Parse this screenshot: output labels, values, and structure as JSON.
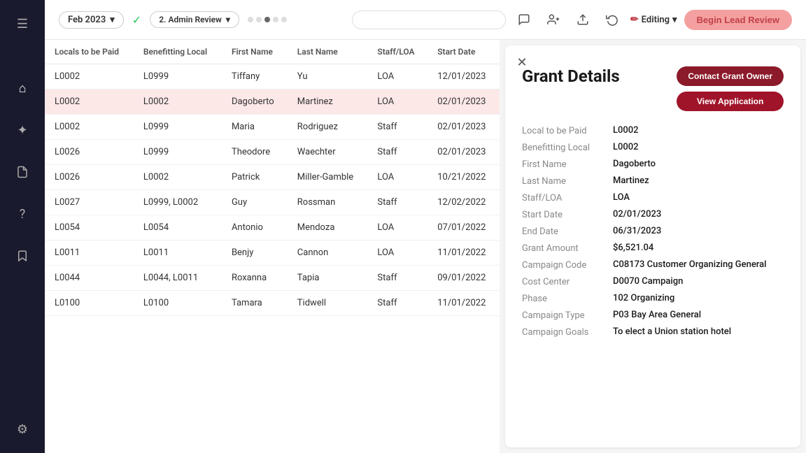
{
  "sidebar": {
    "icons": [
      {
        "name": "menu-icon",
        "symbol": "☰"
      },
      {
        "name": "home-icon",
        "symbol": "⌂"
      },
      {
        "name": "magic-icon",
        "symbol": "✦"
      },
      {
        "name": "document-icon",
        "symbol": "📄"
      },
      {
        "name": "help-icon",
        "symbol": "?"
      },
      {
        "name": "bookmark-icon",
        "symbol": "🔖"
      },
      {
        "name": "settings-icon",
        "symbol": "⚙"
      }
    ]
  },
  "topbar": {
    "date_label": "Feb 2023",
    "step_label": "2. Admin Review",
    "search_placeholder": "",
    "begin_review_label": "Begin Lead Review",
    "editing_label": "Editing"
  },
  "table": {
    "columns": [
      "Locals to be Paid",
      "Benefitting Local",
      "First Name",
      "Last Name",
      "Staff/LOA",
      "Start Date"
    ],
    "rows": [
      {
        "locals_paid": "L0002",
        "benefitting": "L0999",
        "first_name": "Tiffany",
        "last_name": "Yu",
        "staff_loa": "LOA",
        "start_date": "12/01/2023",
        "selected": false
      },
      {
        "locals_paid": "L0002",
        "benefitting": "L0002",
        "first_name": "Dagoberto",
        "last_name": "Martinez",
        "staff_loa": "LOA",
        "start_date": "02/01/2023",
        "selected": true
      },
      {
        "locals_paid": "L0002",
        "benefitting": "L0999",
        "first_name": "Maria",
        "last_name": "Rodriguez",
        "staff_loa": "Staff",
        "start_date": "02/01/2023",
        "selected": false
      },
      {
        "locals_paid": "L0026",
        "benefitting": "L0999",
        "first_name": "Theodore",
        "last_name": "Waechter",
        "staff_loa": "Staff",
        "start_date": "02/01/2023",
        "selected": false
      },
      {
        "locals_paid": "L0026",
        "benefitting": "L0002",
        "first_name": "Patrick",
        "last_name": "Miller-Gamble",
        "staff_loa": "LOA",
        "start_date": "10/21/2022",
        "selected": false
      },
      {
        "locals_paid": "L0027",
        "benefitting": "L0999, L0002",
        "first_name": "Guy",
        "last_name": "Rossman",
        "staff_loa": "Staff",
        "start_date": "12/02/2022",
        "selected": false
      },
      {
        "locals_paid": "L0054",
        "benefitting": "L0054",
        "first_name": "Antonio",
        "last_name": "Mendoza",
        "staff_loa": "LOA",
        "start_date": "07/01/2022",
        "selected": false
      },
      {
        "locals_paid": "L0011",
        "benefitting": "L0011",
        "first_name": "Benjy",
        "last_name": "Cannon",
        "staff_loa": "LOA",
        "start_date": "11/01/2022",
        "selected": false
      },
      {
        "locals_paid": "L0044",
        "benefitting": "L0044, L0011",
        "first_name": "Roxanna",
        "last_name": "Tapia",
        "staff_loa": "Staff",
        "start_date": "09/01/2022",
        "selected": false
      },
      {
        "locals_paid": "L0100",
        "benefitting": "L0100",
        "first_name": "Tamara",
        "last_name": "Tidwell",
        "staff_loa": "Staff",
        "start_date": "11/01/2022",
        "selected": false
      }
    ]
  },
  "detail": {
    "title": "Grant Details",
    "contact_label": "Contact Grant Owner",
    "view_label": "View Application",
    "fields": [
      {
        "label": "Local to be Paid",
        "value": "L0002"
      },
      {
        "label": "Benefitting Local",
        "value": "L0002"
      },
      {
        "label": "First Name",
        "value": "Dagoberto"
      },
      {
        "label": "Last Name",
        "value": "Martinez"
      },
      {
        "label": "Staff/LOA",
        "value": "LOA"
      },
      {
        "label": "Start Date",
        "value": "02/01/2023"
      },
      {
        "label": "End Date",
        "value": "06/31/2023"
      },
      {
        "label": "Grant Amount",
        "value": "$6,521.04"
      },
      {
        "label": "Campaign Code",
        "value": "C08173 Customer Organizing General"
      },
      {
        "label": "Cost Center",
        "value": "D0070 Campaign"
      },
      {
        "label": "Phase",
        "value": "102 Organizing"
      },
      {
        "label": "Campaign Type",
        "value": "P03 Bay Area General"
      },
      {
        "label": "Campaign Goals",
        "value": "To elect a Union station hotel"
      }
    ]
  }
}
